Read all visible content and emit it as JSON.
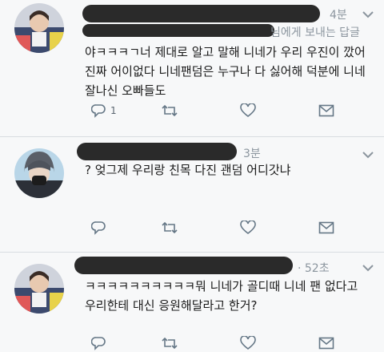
{
  "tweets": [
    {
      "time": "4분",
      "reply_to_suffix": "님에게 보내는 답글",
      "body_lines": [
        "야ㅋㅋㅋㄱ너 제대로 알고 말해 니네가 우리 우진이 깠어",
        "진짜 어이없다 니네팬덤은 누구나 다 싫어해 덕분에 니네",
        "잘나신 오빠들도"
      ],
      "reply_count": "1"
    },
    {
      "time": "3분",
      "body_lines": [
        "? 엊그제 우리랑 친목 다진 괜덤 어디갓냐"
      ]
    },
    {
      "time": "· 52초",
      "body_lines": [
        "ㅋㅋㅋㅋㅋㅋㅋㅋㅋㅋ뭐 니네가 골디때 니네 팬 없다고",
        "우리한테 대신 응원해달라고 한거?"
      ]
    }
  ],
  "icons": {
    "reply": "reply-icon",
    "retweet": "retweet-icon",
    "like": "heart-icon",
    "dm": "mail-icon",
    "more": "chevron-down-icon"
  },
  "colors": {
    "background": "#f7f8f9",
    "icon": "#657786",
    "redaction": "#2a2a2a",
    "meta_text": "#8b959e"
  }
}
